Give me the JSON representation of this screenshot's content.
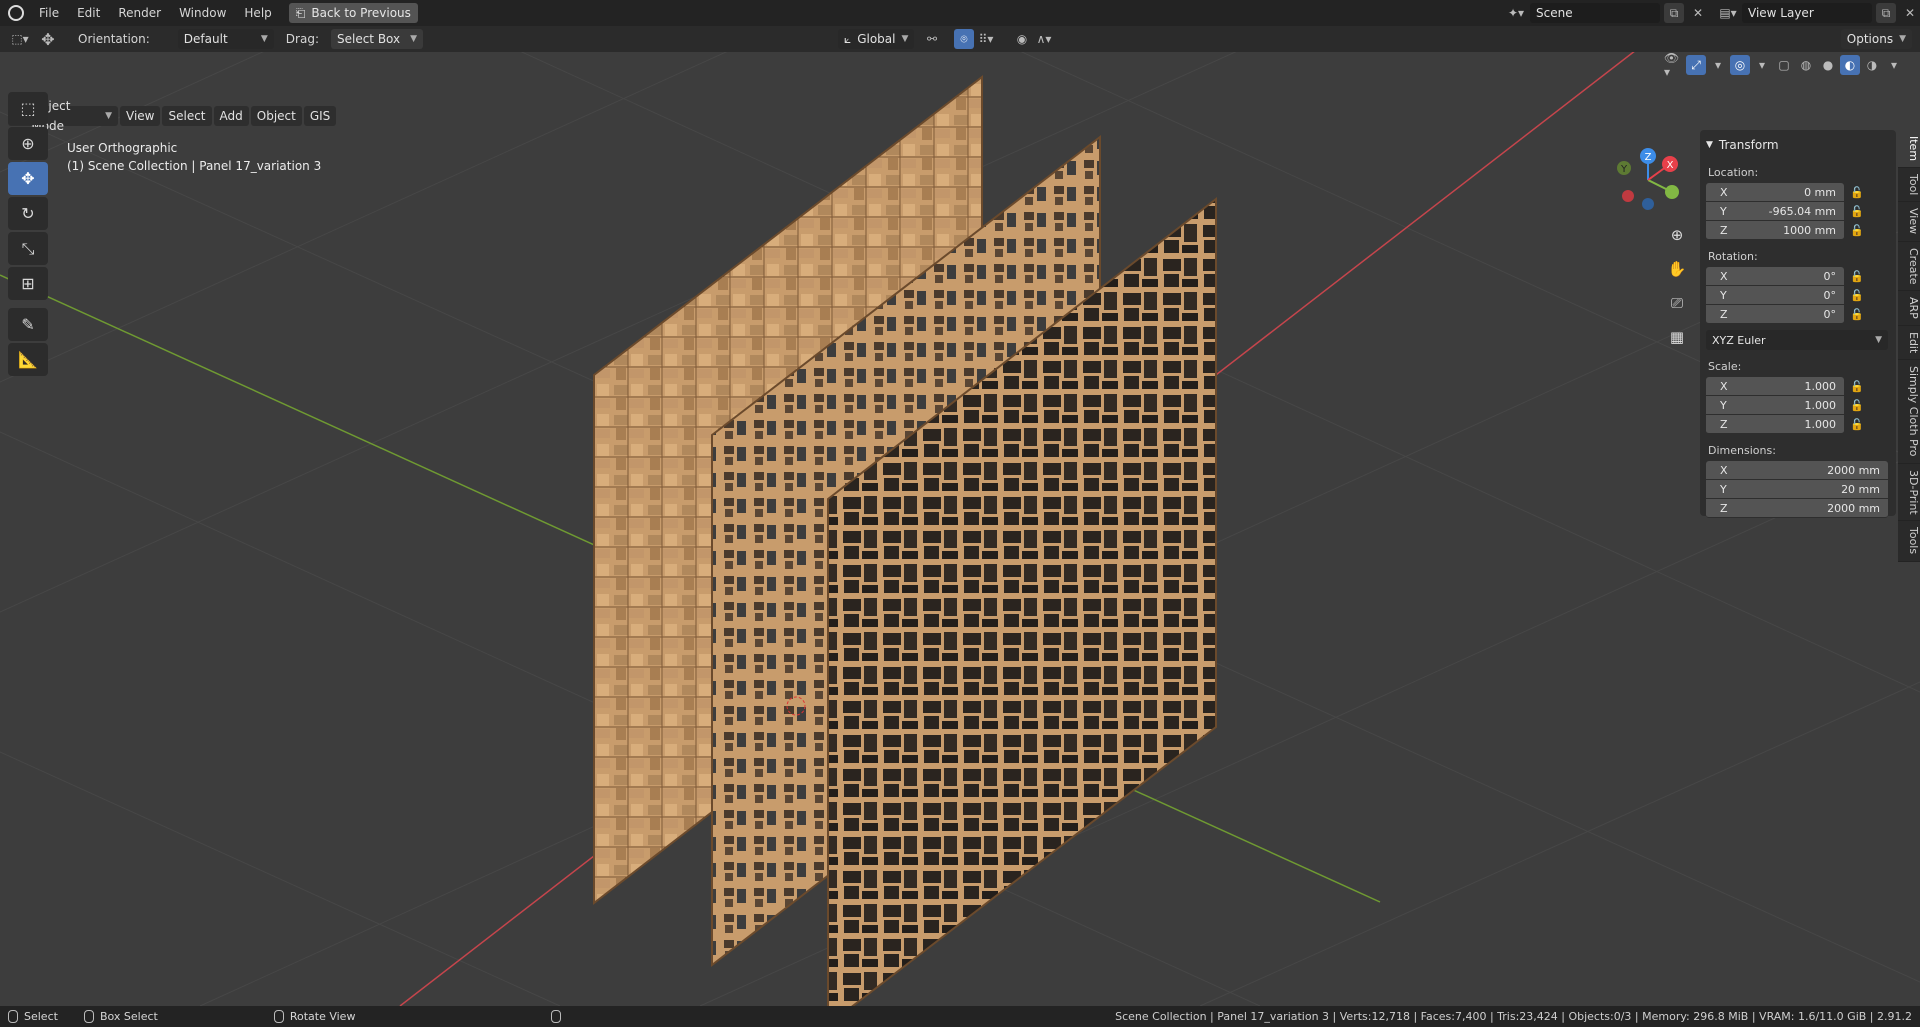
{
  "menu": {
    "file": "File",
    "edit": "Edit",
    "render": "Render",
    "window": "Window",
    "help": "Help",
    "back": "Back to Previous"
  },
  "scene": {
    "label": "Scene",
    "view_layer": "View Layer"
  },
  "header": {
    "orientation_label": "Orientation:",
    "orientation_value": "Default",
    "drag_label": "Drag:",
    "drag_value": "Select Box",
    "transform_orientation": "Global",
    "options": "Options"
  },
  "mode": {
    "object_mode": "Object Mode",
    "view": "View",
    "select": "Select",
    "add": "Add",
    "object": "Object",
    "gis": "GIS"
  },
  "viewport": {
    "view_name": "User Orthographic",
    "collection": "(1) Scene Collection | Panel 17_variation 3"
  },
  "gizmo": {
    "x": "X",
    "y": "Y",
    "z": "Z"
  },
  "transform": {
    "title": "Transform",
    "location_label": "Location:",
    "loc": [
      {
        "axis": "X",
        "value": "0 mm"
      },
      {
        "axis": "Y",
        "value": "-965.04 mm"
      },
      {
        "axis": "Z",
        "value": "1000 mm"
      }
    ],
    "rotation_label": "Rotation:",
    "rot": [
      {
        "axis": "X",
        "value": "0°"
      },
      {
        "axis": "Y",
        "value": "0°"
      },
      {
        "axis": "Z",
        "value": "0°"
      }
    ],
    "rotation_mode": "XYZ Euler",
    "scale_label": "Scale:",
    "scale": [
      {
        "axis": "X",
        "value": "1.000"
      },
      {
        "axis": "Y",
        "value": "1.000"
      },
      {
        "axis": "Z",
        "value": "1.000"
      }
    ],
    "dimensions_label": "Dimensions:",
    "dim": [
      {
        "axis": "X",
        "value": "2000 mm"
      },
      {
        "axis": "Y",
        "value": "20 mm"
      },
      {
        "axis": "Z",
        "value": "2000 mm"
      }
    ]
  },
  "tabs": [
    "Item",
    "Tool",
    "View",
    "Create",
    "ARP",
    "Edit",
    "Simply Cloth Pro",
    "3D-Print",
    "Tools"
  ],
  "status": {
    "select": "Select",
    "box_select": "Box Select",
    "rotate_view": "Rotate View",
    "stats": "Scene Collection | Panel 17_variation 3 | Verts:12,718 | Faces:7,400 | Tris:23,424 | Objects:0/3 | Memory: 296.8 MiB | VRAM: 1.6/11.0 GiB | 2.91.2"
  },
  "colors": {
    "accent": "#4772b3",
    "x_axis": "#e8404a",
    "y_axis": "#82b844",
    "z_axis": "#3d8de8",
    "wood": "#c79a6a",
    "dark_panel": "#2a241f"
  }
}
